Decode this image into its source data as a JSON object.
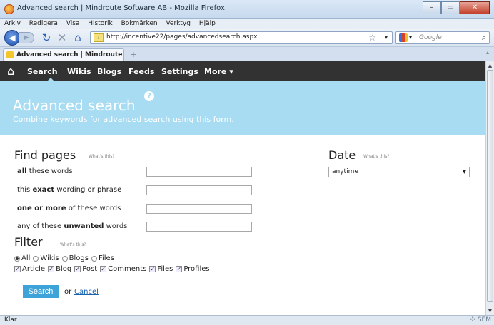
{
  "browser": {
    "title": "Advanced search | Mindroute Software AB - Mozilla Firefox",
    "menu": [
      "Arkiv",
      "Redigera",
      "Visa",
      "Historik",
      "Bokmärken",
      "Verktyg",
      "Hjälp"
    ],
    "url": "http://incentive22/pages/advancedsearch.aspx",
    "search_placeholder": "Google",
    "tab_title": "Advanced search | Mindroute Softwa...",
    "status": "Klar",
    "status_right": "SEM"
  },
  "site_nav": {
    "items": [
      "Search",
      "Wikis",
      "Blogs",
      "Feeds",
      "Settings",
      "More ▾"
    ]
  },
  "hero": {
    "title": "Advanced search",
    "subtitle": "Combine keywords for advanced search using this form."
  },
  "find_pages": {
    "heading": "Find pages",
    "whats_this": "What's this?",
    "rows": [
      {
        "pre": "",
        "bold": "all",
        "post": " these words"
      },
      {
        "pre": "this ",
        "bold": "exact",
        "post": " wording or phrase"
      },
      {
        "pre": "",
        "bold": "one or more",
        "post": " of these words"
      },
      {
        "pre": "any of these ",
        "bold": "unwanted",
        "post": " words"
      }
    ]
  },
  "date": {
    "heading": "Date",
    "whats_this": "What's this?",
    "selected": "anytime"
  },
  "filter": {
    "heading": "Filter",
    "whats_this": "What's this?",
    "radios": [
      "All",
      "Wikis",
      "Blogs",
      "Files"
    ],
    "radio_selected": "All",
    "checks": [
      "Article",
      "Blog",
      "Post",
      "Comments",
      "Files",
      "Profiles"
    ]
  },
  "actions": {
    "search": "Search",
    "or": "or",
    "cancel": "Cancel"
  },
  "colors": {
    "nav_bg": "#323232",
    "hero_bg": "#a8dcf2",
    "button": "#3ea3d9",
    "link": "#1a64b0"
  }
}
